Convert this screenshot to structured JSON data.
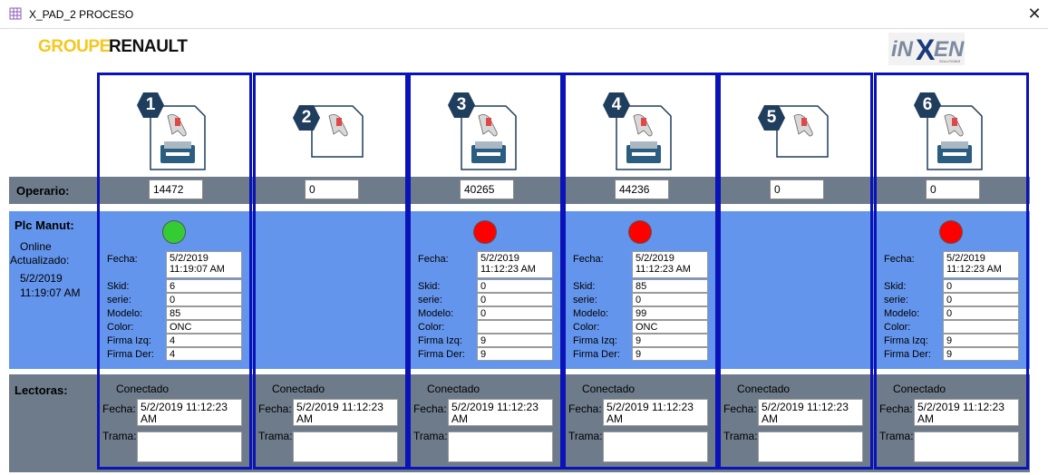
{
  "window": {
    "title": "X_PAD_2 PROCESO",
    "close": "✕"
  },
  "brand": {
    "left_a": "GROUPE",
    "left_b": "RENAULT",
    "right": "iNXEN",
    "right_sub": "SOLUTIONS",
    "colors": {
      "groupe": "#f4c81e",
      "renault": "#111111",
      "inxen": "#1a3a7a"
    }
  },
  "rows": {
    "operario": "Operario:",
    "plc": "Plc Manut:",
    "plc_status": "Online",
    "plc_updated": "Actualizado:",
    "plc_date": "5/2/2019",
    "plc_time": "11:19:07 AM",
    "lectoras": "Lectoras:"
  },
  "field_labels": {
    "fecha": "Fecha:",
    "skid": "Skid:",
    "serie": "serie:",
    "modelo": "Modelo:",
    "color": "Color:",
    "firma_izq": "Firma Izq:",
    "firma_der": "Firma Der:",
    "trama": "Trama:"
  },
  "colors": {
    "column_border": "#0a13b8",
    "operario_band": "#6d7b8b",
    "plc_band": "#6495ed",
    "led_green": "#33cc33",
    "led_red": "#ff0000",
    "hex": "#1f3d5c"
  },
  "stations": [
    {
      "num": "1",
      "icon": "printer-scanner-icon",
      "operario": "14472",
      "plc": true,
      "led": "green",
      "fecha": "5/2/2019\n11:19:07 AM",
      "skid": "6",
      "serie": "0",
      "modelo": "85",
      "color": "ONC",
      "firma_izq": "4",
      "firma_der": "4",
      "lec_status": "Conectado",
      "lec_fecha": "5/2/2019 11:12:23 AM",
      "trama": ""
    },
    {
      "num": "2",
      "icon": "scanner-icon",
      "operario": "0",
      "plc": false,
      "lec_status": "Conectado",
      "lec_fecha": "5/2/2019 11:12:23 AM",
      "trama": ""
    },
    {
      "num": "3",
      "icon": "printer-scanner-icon",
      "operario": "40265",
      "plc": true,
      "led": "red",
      "fecha": "5/2/2019\n11:12:23 AM",
      "skid": "0",
      "serie": "0",
      "modelo": "0",
      "color": "",
      "firma_izq": "9",
      "firma_der": "9",
      "lec_status": "Conectado",
      "lec_fecha": "5/2/2019 11:12:23 AM",
      "trama": ""
    },
    {
      "num": "4",
      "icon": "printer-scanner-icon",
      "operario": "44236",
      "plc": true,
      "led": "red",
      "fecha": "5/2/2019\n11:12:23 AM",
      "skid": "85",
      "serie": "0",
      "modelo": "99",
      "color": "ONC",
      "firma_izq": "9",
      "firma_der": "9",
      "lec_status": "Conectado",
      "lec_fecha": "5/2/2019 11:12:23 AM",
      "trama": ""
    },
    {
      "num": "5",
      "icon": "scanner-icon",
      "operario": "0",
      "plc": false,
      "lec_status": "Conectado",
      "lec_fecha": "5/2/2019 11:12:23 AM",
      "trama": ""
    },
    {
      "num": "6",
      "icon": "printer-scanner-icon",
      "operario": "0",
      "plc": true,
      "led": "red",
      "fecha": "5/2/2019\n11:12:23 AM",
      "skid": "0",
      "serie": "0",
      "modelo": "0",
      "color": "",
      "firma_izq": "9",
      "firma_der": "9",
      "lec_status": "Conectado",
      "lec_fecha": "5/2/2019 11:12:23 AM",
      "trama": ""
    }
  ]
}
